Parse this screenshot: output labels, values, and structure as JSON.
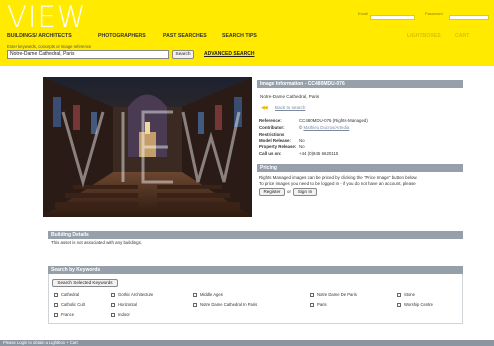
{
  "header": {
    "logo": "VIEW",
    "login": {
      "email_label": "Email",
      "password_label": "Password"
    },
    "nav": [
      "BUILDINGS/ ARCHITECTS",
      "PHOTOGRAPHERS",
      "PAST SEARCHES",
      "SEARCH TIPS"
    ],
    "nav_right": [
      "LIGHTBOXES",
      "CART"
    ],
    "search_hint": "Enter keywords, concepts or image reference",
    "search_value": "Notre-Dame Cathedral, Paris",
    "search_button": "Search",
    "advanced_search": "ADVANCED SEARCH"
  },
  "info": {
    "header": "Image Information - CC480MDU-076",
    "title": "Notre-Dame Cathedral, Paris",
    "back_arrows": "◀◀",
    "back_link": "Back to search",
    "meta": [
      {
        "label": "Reference:",
        "value": "CC480MDU-076 (Rights-Managed)"
      },
      {
        "label": "Contributor:",
        "value": "© ",
        "link": "Mathieu Ducros/Artedia"
      },
      {
        "label": "Restrictions",
        "value": ""
      },
      {
        "label": "Model Release:",
        "value": "No"
      },
      {
        "label": "Property Release:",
        "value": "No"
      },
      {
        "label": "Call us on:",
        "value": "+44 (0)845 6620115"
      }
    ]
  },
  "pricing": {
    "header": "Pricing",
    "line1": "Rights Managed images can be priced by clicking the \"Price Image\" button below.",
    "line2": "To price images you need to be logged in - if you do not have an account, please",
    "register": "Register",
    "or": "or",
    "signin": "Sign In"
  },
  "building": {
    "header": "Building Details",
    "text": "This asset is not associated with any buildings."
  },
  "keywords": {
    "header": "Search by Keywords",
    "button": "Search Selected Keywords",
    "items": [
      [
        "Cathedral",
        "Gothic Architecture",
        "Middle Ages",
        "Notre Dame De Paris",
        "Stone"
      ],
      [
        "Catholic Cult",
        "Horizontal",
        "Notre Dame Cathedral In Paris",
        "Paris",
        "Worship Centre"
      ],
      [
        "France",
        "Indoor"
      ]
    ]
  },
  "footer": {
    "text": "Please Login to obtain a Lightbox + Cart"
  },
  "colors": {
    "header_bg": "#ffea00",
    "panel_head": "#95a0ab",
    "link": "#7a8aa0",
    "arrow": "#e8b800"
  }
}
